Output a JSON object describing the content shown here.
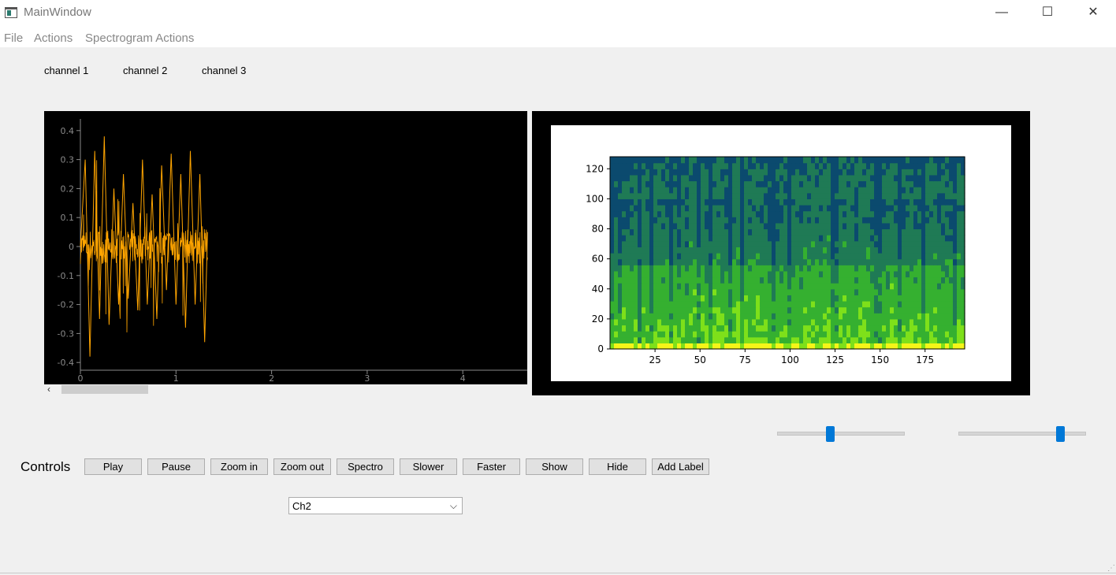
{
  "window": {
    "title": "MainWindow",
    "minimize_glyph": "—",
    "maximize_glyph": "☐",
    "close_glyph": "✕"
  },
  "menu": [
    "File",
    "Actions",
    "Spectrogram Actions"
  ],
  "channels": [
    "channel 1",
    "channel 2",
    "channel 3"
  ],
  "signal_plot": {
    "background": "#000000",
    "trace_color": "#ffa500",
    "x_ticks": [
      "0",
      "1",
      "2",
      "3",
      "4"
    ],
    "y_ticks": [
      "0.4",
      "0.3",
      "0.2",
      "0.1",
      "0",
      "-0.1",
      "-0.2",
      "-0.3",
      "-0.4"
    ],
    "scroll_left_glyph": "‹"
  },
  "chart_data": [
    {
      "type": "line",
      "x_ticks": [
        0,
        1,
        2,
        3,
        4
      ],
      "y_ticks": [
        0.4,
        0.3,
        0.2,
        0.1,
        0,
        -0.1,
        -0.2,
        -0.3,
        -0.4
      ],
      "xlim": [
        0,
        4.6
      ],
      "ylim": [
        -0.42,
        0.42
      ],
      "grid": false,
      "series": [
        {
          "color": "#ffa500",
          "x": [
            0,
            0.05,
            0.1,
            0.15,
            0.2,
            0.25,
            0.3,
            0.35,
            0.4,
            0.45,
            0.5,
            0.55,
            0.6,
            0.65,
            0.7,
            0.75,
            0.8,
            0.85,
            0.9,
            0.95,
            1.0,
            1.05,
            1.1,
            1.15,
            1.2,
            1.25,
            1.3,
            1.33
          ],
          "y": [
            0.0,
            0.3,
            -0.38,
            0.33,
            -0.25,
            0.38,
            -0.27,
            0.2,
            -0.2,
            0.25,
            -0.18,
            0.15,
            -0.22,
            0.3,
            -0.2,
            0.18,
            -0.25,
            0.28,
            -0.15,
            0.32,
            -0.2,
            0.25,
            -0.28,
            0.33,
            -0.2,
            0.25,
            -0.33,
            0.05
          ]
        }
      ]
    },
    {
      "type": "heatmap",
      "x_ticks": [
        25,
        50,
        75,
        100,
        125,
        150,
        175
      ],
      "y_ticks": [
        0,
        20,
        40,
        60,
        80,
        100,
        120
      ],
      "xlim": [
        0,
        197
      ],
      "ylim": [
        0,
        128
      ],
      "colormap": [
        "#0b4a6e",
        "#1f7a55",
        "#35b030",
        "#7ee01a",
        "#f5f518"
      ],
      "grid": false
    }
  ],
  "sliders": [
    {
      "name": "speed",
      "value": 0.42
    },
    {
      "name": "spectro-level",
      "value": 0.81
    }
  ],
  "controls": {
    "label": "Controls",
    "buttons": [
      "Play",
      "Pause",
      "Zoom in",
      "Zoom out",
      "Spectro",
      "Slower",
      "Faster",
      "Show",
      "Hide",
      "Add Label"
    ]
  },
  "channel_select": {
    "value": "Ch2",
    "chevron": "⌵"
  },
  "size_grip": "⋰"
}
